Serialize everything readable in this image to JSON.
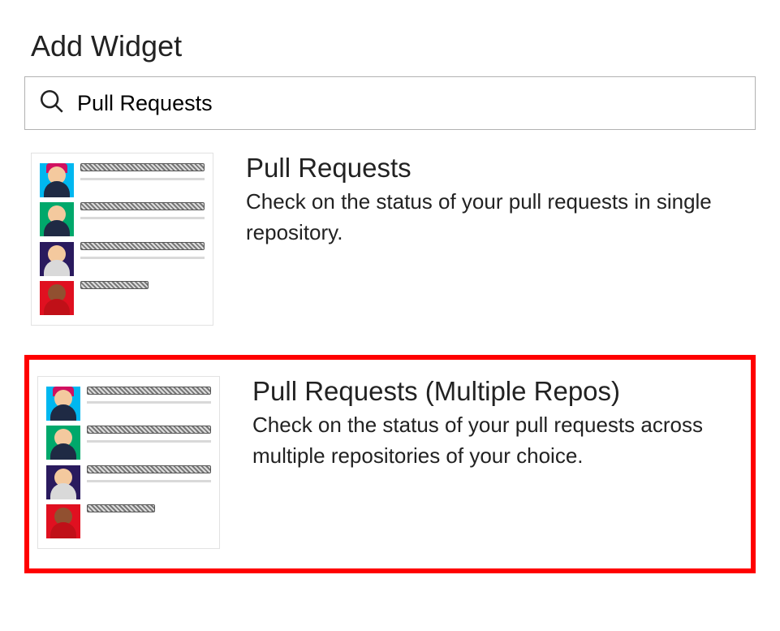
{
  "page_title": "Add Widget",
  "search": {
    "value": "Pull Requests",
    "placeholder": "Search"
  },
  "widgets": [
    {
      "title": "Pull Requests",
      "description": "Check on the status of your pull requests in single repository.",
      "highlighted": false
    },
    {
      "title": "Pull Requests (Multiple Repos)",
      "description": "Check on the status of your pull requests across multiple repositories of your choice.",
      "highlighted": true
    }
  ]
}
